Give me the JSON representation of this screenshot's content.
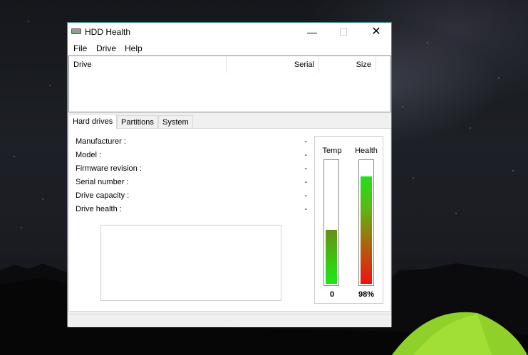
{
  "window": {
    "title": "HDD Health"
  },
  "window_controls": {
    "minimize": "—",
    "maximize": "☐",
    "close": "✕"
  },
  "menu": [
    "File",
    "Drive",
    "Help"
  ],
  "drive_list": {
    "columns": [
      "Drive",
      "Serial",
      "Size"
    ],
    "rows": []
  },
  "tabs": [
    "Hard drives",
    "Partitions",
    "System"
  ],
  "active_tab": "Hard drives",
  "drive_info": [
    {
      "label": "Manufacturer :",
      "value": "-"
    },
    {
      "label": "Model :",
      "value": "-"
    },
    {
      "label": "Firmware revision :",
      "value": "-"
    },
    {
      "label": "Serial number :",
      "value": "-"
    },
    {
      "label": "Drive capacity :",
      "value": "-"
    },
    {
      "label": "Drive health :",
      "value": "-"
    }
  ],
  "gauges": {
    "temp": {
      "label": "Temp",
      "value": "0",
      "fill_fraction": 0.44
    },
    "health": {
      "label": "Health",
      "value": "98%",
      "fill_fraction": 0.88
    }
  },
  "colors": {
    "window_border": "#2d8f8c",
    "temp_fill": "#1ee81a",
    "health_high": "#22e01a",
    "health_low": "#f0120e"
  }
}
